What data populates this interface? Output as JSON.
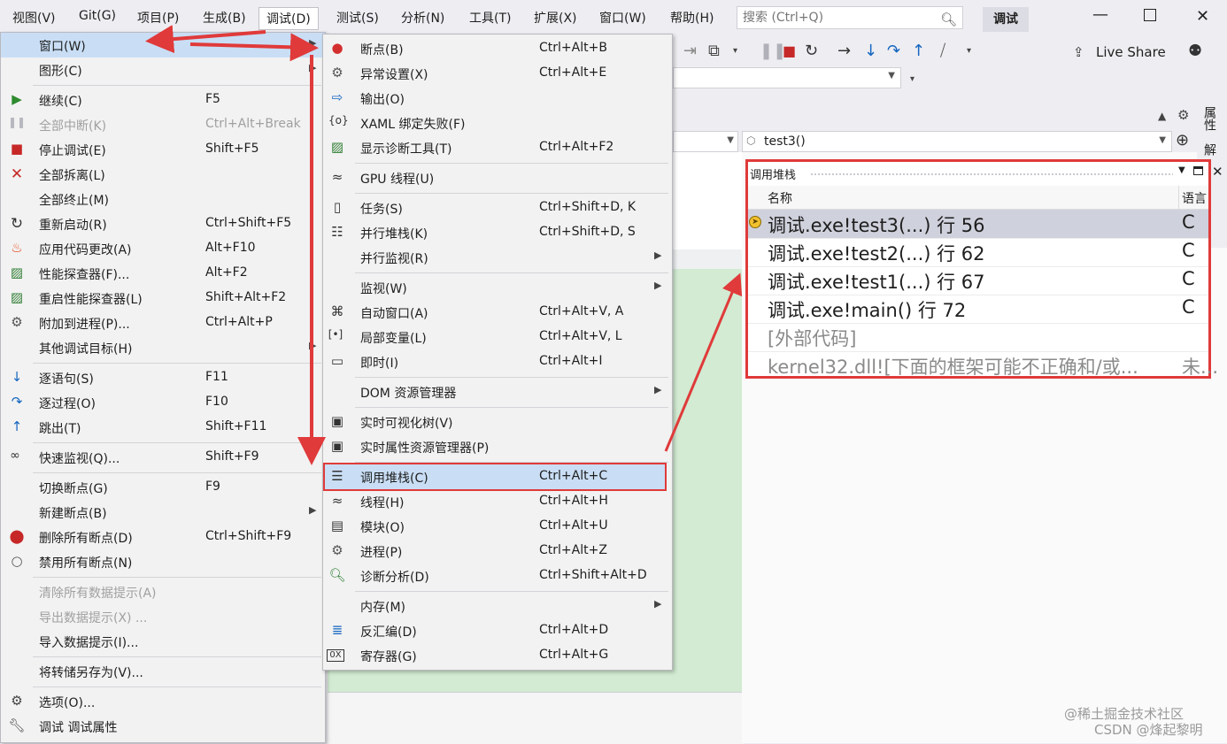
{
  "menubar": {
    "items": [
      "视图(V)",
      "Git(G)",
      "项目(P)",
      "生成(B)",
      "调试(D)",
      "测试(S)",
      "分析(N)",
      "工具(T)",
      "扩展(X)",
      "窗口(W)",
      "帮助(H)"
    ],
    "search_placeholder": "搜索 (Ctrl+Q)",
    "solution_name": "调试"
  },
  "toolbar": {
    "live_share": "Live Share",
    "function_combo": "test3()"
  },
  "debug_menu": {
    "items": [
      {
        "label": "窗口(W)",
        "shortcut": "",
        "icon": "window-icon",
        "submenu": true
      },
      {
        "label": "图形(C)",
        "shortcut": "",
        "icon": "",
        "submenu": true
      },
      {
        "label": "继续(C)",
        "shortcut": "F5",
        "icon": "play-icon"
      },
      {
        "label": "全部中断(K)",
        "shortcut": "Ctrl+Alt+Break",
        "icon": "pause-icon",
        "disabled": true
      },
      {
        "label": "停止调试(E)",
        "shortcut": "Shift+F5",
        "icon": "stop-icon"
      },
      {
        "label": "全部拆离(L)",
        "shortcut": "",
        "icon": "detach-icon"
      },
      {
        "label": "全部终止(M)",
        "shortcut": "",
        "icon": ""
      },
      {
        "label": "重新启动(R)",
        "shortcut": "Ctrl+Shift+F5",
        "icon": "restart-icon"
      },
      {
        "label": "应用代码更改(A)",
        "shortcut": "Alt+F10",
        "icon": "flame-icon"
      },
      {
        "label": "性能探查器(F)...",
        "shortcut": "Alt+F2",
        "icon": "profiler-icon"
      },
      {
        "label": "重启性能探查器(L)",
        "shortcut": "Shift+Alt+F2",
        "icon": "profiler-icon"
      },
      {
        "label": "附加到进程(P)...",
        "shortcut": "Ctrl+Alt+P",
        "icon": "gear-icon"
      },
      {
        "label": "其他调试目标(H)",
        "shortcut": "",
        "icon": "",
        "submenu": true
      },
      {
        "label": "逐语句(S)",
        "shortcut": "F11",
        "icon": "step-into-icon"
      },
      {
        "label": "逐过程(O)",
        "shortcut": "F10",
        "icon": "step-over-icon"
      },
      {
        "label": "跳出(T)",
        "shortcut": "Shift+F11",
        "icon": "step-out-icon"
      },
      {
        "label": "快速监视(Q)...",
        "shortcut": "Shift+F9",
        "icon": "glasses-icon"
      },
      {
        "label": "切换断点(G)",
        "shortcut": "F9",
        "icon": ""
      },
      {
        "label": "新建断点(B)",
        "shortcut": "",
        "icon": "",
        "submenu": true
      },
      {
        "label": "删除所有断点(D)",
        "shortcut": "Ctrl+Shift+F9",
        "icon": "delete-breakpoints-icon"
      },
      {
        "label": "禁用所有断点(N)",
        "shortcut": "",
        "icon": "disable-breakpoints-icon"
      },
      {
        "label": "清除所有数据提示(A)",
        "shortcut": "",
        "icon": "",
        "disabled": true
      },
      {
        "label": "导出数据提示(X) ...",
        "shortcut": "",
        "icon": "",
        "disabled": true
      },
      {
        "label": "导入数据提示(I)...",
        "shortcut": "",
        "icon": ""
      },
      {
        "label": "将转储另存为(V)...",
        "shortcut": "",
        "icon": ""
      },
      {
        "label": "选项(O)...",
        "shortcut": "",
        "icon": "gear-icon"
      },
      {
        "label": "调试 调试属性",
        "shortcut": "",
        "icon": "wrench-icon"
      }
    ]
  },
  "window_menu": {
    "items": [
      {
        "label": "断点(B)",
        "shortcut": "Ctrl+Alt+B",
        "icon": "breakpoint-icon"
      },
      {
        "label": "异常设置(X)",
        "shortcut": "Ctrl+Alt+E",
        "icon": "exception-icon"
      },
      {
        "label": "输出(O)",
        "shortcut": "",
        "icon": "output-icon"
      },
      {
        "label": "XAML 绑定失败(F)",
        "shortcut": "",
        "icon": "xaml-icon"
      },
      {
        "label": "显示诊断工具(T)",
        "shortcut": "Ctrl+Alt+F2",
        "icon": "diagnostics-icon"
      },
      {
        "label": "GPU 线程(U)",
        "shortcut": "",
        "icon": "gpu-thread-icon"
      },
      {
        "label": "任务(S)",
        "shortcut": "Ctrl+Shift+D, K",
        "icon": "tasks-icon"
      },
      {
        "label": "并行堆栈(K)",
        "shortcut": "Ctrl+Shift+D, S",
        "icon": "parallel-stacks-icon"
      },
      {
        "label": "并行监视(R)",
        "shortcut": "",
        "icon": "",
        "submenu": true
      },
      {
        "label": "监视(W)",
        "shortcut": "",
        "icon": "",
        "submenu": true
      },
      {
        "label": "自动窗口(A)",
        "shortcut": "Ctrl+Alt+V, A",
        "icon": "autos-icon"
      },
      {
        "label": "局部变量(L)",
        "shortcut": "Ctrl+Alt+V, L",
        "icon": "locals-icon"
      },
      {
        "label": "即时(I)",
        "shortcut": "Ctrl+Alt+I",
        "icon": "immediate-icon"
      },
      {
        "label": "DOM 资源管理器",
        "shortcut": "",
        "icon": "",
        "submenu": true
      },
      {
        "label": "实时可视化树(V)",
        "shortcut": "",
        "icon": "camera-icon"
      },
      {
        "label": "实时属性资源管理器(P)",
        "shortcut": "",
        "icon": "camera-icon"
      },
      {
        "label": "调用堆栈(C)",
        "shortcut": "Ctrl+Alt+C",
        "icon": "call-stack-icon",
        "highlight": true
      },
      {
        "label": "线程(H)",
        "shortcut": "Ctrl+Alt+H",
        "icon": "threads-icon"
      },
      {
        "label": "模块(O)",
        "shortcut": "Ctrl+Alt+U",
        "icon": "modules-icon"
      },
      {
        "label": "进程(P)",
        "shortcut": "Ctrl+Alt+Z",
        "icon": "processes-icon"
      },
      {
        "label": "诊断分析(D)",
        "shortcut": "Ctrl+Shift+Alt+D",
        "icon": "diagnostic-analysis-icon"
      },
      {
        "label": "内存(M)",
        "shortcut": "",
        "icon": "",
        "submenu": true
      },
      {
        "label": "反汇编(D)",
        "shortcut": "Ctrl+Alt+D",
        "icon": "disassembly-icon"
      },
      {
        "label": "寄存器(G)",
        "shortcut": "Ctrl+Alt+G",
        "icon": "registers-icon"
      }
    ]
  },
  "call_stack": {
    "title": "调用堆栈",
    "col_name": "名称",
    "col_lang": "语言",
    "rows": [
      {
        "name": "调试.exe!test3(...) 行 56",
        "lang": "C"
      },
      {
        "name": "调试.exe!test2(...) 行 62",
        "lang": "C"
      },
      {
        "name": "调试.exe!test1(...) 行 67",
        "lang": "C"
      },
      {
        "name": "调试.exe!main() 行 72",
        "lang": "C"
      },
      {
        "name": "[外部代码]",
        "lang": ""
      },
      {
        "name": "kernel32.dll![下面的框架可能不正确和/或...",
        "lang": "未..."
      }
    ]
  },
  "side_labels": [
    "属性",
    "解"
  ],
  "watermark": {
    "line1": "@稀土掘金技术社区",
    "line2": "CSDN @烽起黎明"
  },
  "colors": {
    "annotation_red": "#e03a3a",
    "menu_highlight": "#c9def5",
    "editor_green": "#d2ebd2"
  }
}
